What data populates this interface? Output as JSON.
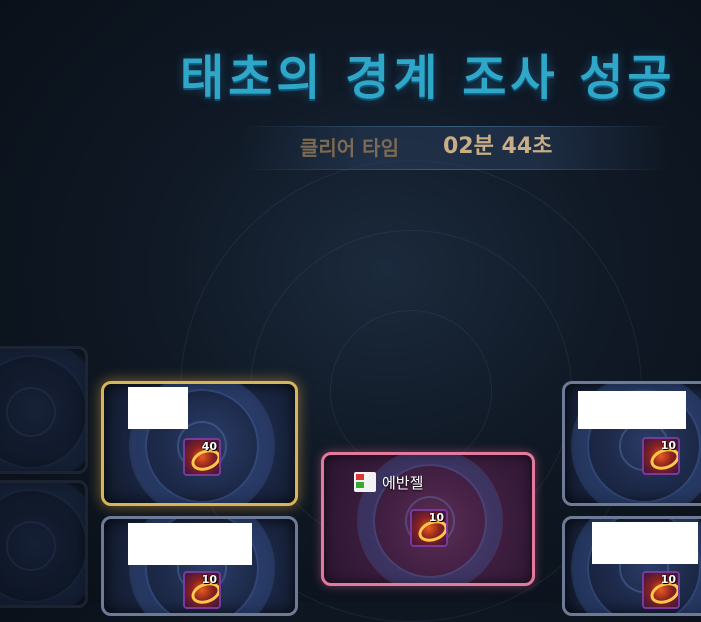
{
  "result": {
    "title": "태초의 경계 조사 성공",
    "clear_label": "클리어 타임",
    "clear_time": "02분 44초"
  },
  "cards": [
    {
      "id": "left-top-faded",
      "state": "faded"
    },
    {
      "id": "left-bottom-faded",
      "state": "faded"
    },
    {
      "id": "gold-card",
      "state": "gold",
      "name_redacted": true,
      "item": {
        "icon": "ring-item-icon",
        "quantity": "40"
      }
    },
    {
      "id": "bottom-left-card",
      "state": "normal",
      "name_redacted": true,
      "item": {
        "icon": "ring-item-icon",
        "quantity": "10"
      }
    },
    {
      "id": "center-card",
      "state": "highlight",
      "player": "에반젤",
      "party_icon": "party-icon",
      "item": {
        "icon": "ring-item-icon",
        "quantity": "10"
      }
    },
    {
      "id": "right-top-card",
      "state": "normal",
      "name_redacted": true,
      "item": {
        "icon": "ring-item-icon",
        "quantity": "10"
      }
    },
    {
      "id": "right-bottom-card",
      "state": "normal",
      "name_redacted": true,
      "item": {
        "icon": "ring-item-icon",
        "quantity": "10"
      }
    }
  ],
  "colors": {
    "title": "#2ea7c8",
    "clear_label": "#7d6a52",
    "clear_time": "#c8ad86",
    "gold_border": "#d8b55a",
    "pink_border": "#e3799d"
  }
}
